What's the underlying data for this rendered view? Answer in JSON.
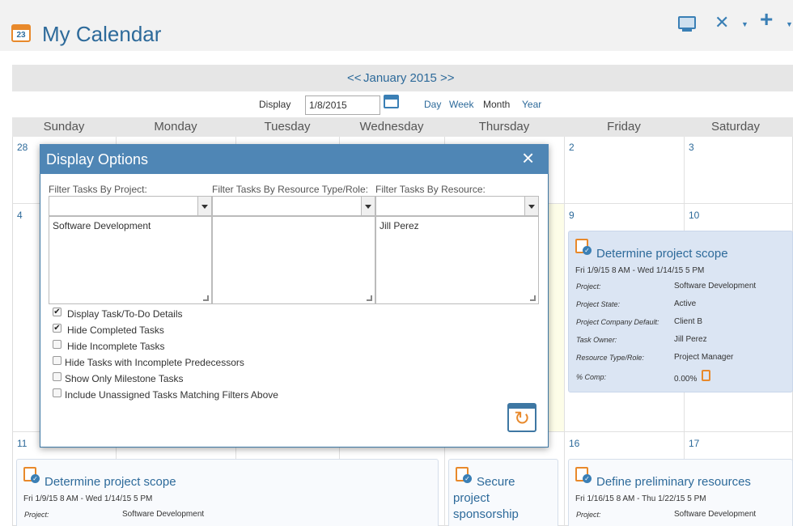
{
  "header": {
    "title": "My Calendar",
    "calendar_day": "23",
    "icons": [
      "monitor-icon",
      "wrench-icon",
      "plus-icon"
    ]
  },
  "nav": {
    "prev": "<<",
    "next": ">>",
    "period": "January 2015"
  },
  "display": {
    "label": "Display",
    "date_value": "1/8/2015",
    "views": [
      "Day",
      "Week",
      "Month",
      "Year"
    ]
  },
  "weekdays": [
    "Sunday",
    "Monday",
    "Tuesday",
    "Wednesday",
    "Thursday",
    "Friday",
    "Saturday"
  ],
  "days": {
    "r1": [
      "28",
      "2",
      "3"
    ],
    "r2": [
      "4",
      "9",
      "10"
    ],
    "r3": [
      "11",
      "16",
      "17"
    ]
  },
  "modal": {
    "title": "Display Options",
    "close": "×",
    "filters": [
      {
        "label": "Filter Tasks By Project:",
        "items": [
          "Software Development"
        ]
      },
      {
        "label": "Filter Tasks By Resource Type/Role:",
        "items": []
      },
      {
        "label": "Filter Tasks By Resource:",
        "items": [
          "Jill Perez"
        ]
      }
    ],
    "options": [
      {
        "label": "Display Task/To-Do Details",
        "checked": true
      },
      {
        "label": "Hide Completed Tasks",
        "checked": true
      },
      {
        "label": "Hide Incomplete Tasks",
        "checked": false
      },
      {
        "label": "Hide Tasks with Incomplete Predecessors",
        "checked": false
      },
      {
        "label": "Show Only Milestone Tasks",
        "checked": false
      },
      {
        "label": "Include Unassigned Tasks Matching Filters Above",
        "checked": false
      }
    ]
  },
  "tasks": [
    {
      "title": "Determine project scope",
      "dates": "Fri 1/9/15 8 AM - Wed 1/14/15 5 PM",
      "fields": [
        {
          "label": "Project:",
          "value": "Software Development"
        },
        {
          "label": "Project State:",
          "value": "Active"
        },
        {
          "label": "Project Company Default:",
          "value": "Client B"
        },
        {
          "label": "Task Owner:",
          "value": "Jill Perez"
        },
        {
          "label": "Resource Type/Role:",
          "value": "Project Manager"
        },
        {
          "label": "% Comp:",
          "value": "0.00%"
        }
      ]
    },
    {
      "title": "Determine project scope",
      "dates": "Fri 1/9/15 8 AM - Wed 1/14/15 5 PM",
      "fields": [
        {
          "label": "Project:",
          "value": "Software Development"
        }
      ]
    },
    {
      "title": "Secure project sponsorship",
      "title_lines": [
        "Secure",
        "project",
        "sponsorship"
      ]
    },
    {
      "title": "Define preliminary resources",
      "dates": "Fri 1/16/15 8 AM - Thu 1/22/15 5 PM",
      "fields": [
        {
          "label": "Project:",
          "value": "Software Development"
        }
      ]
    }
  ]
}
